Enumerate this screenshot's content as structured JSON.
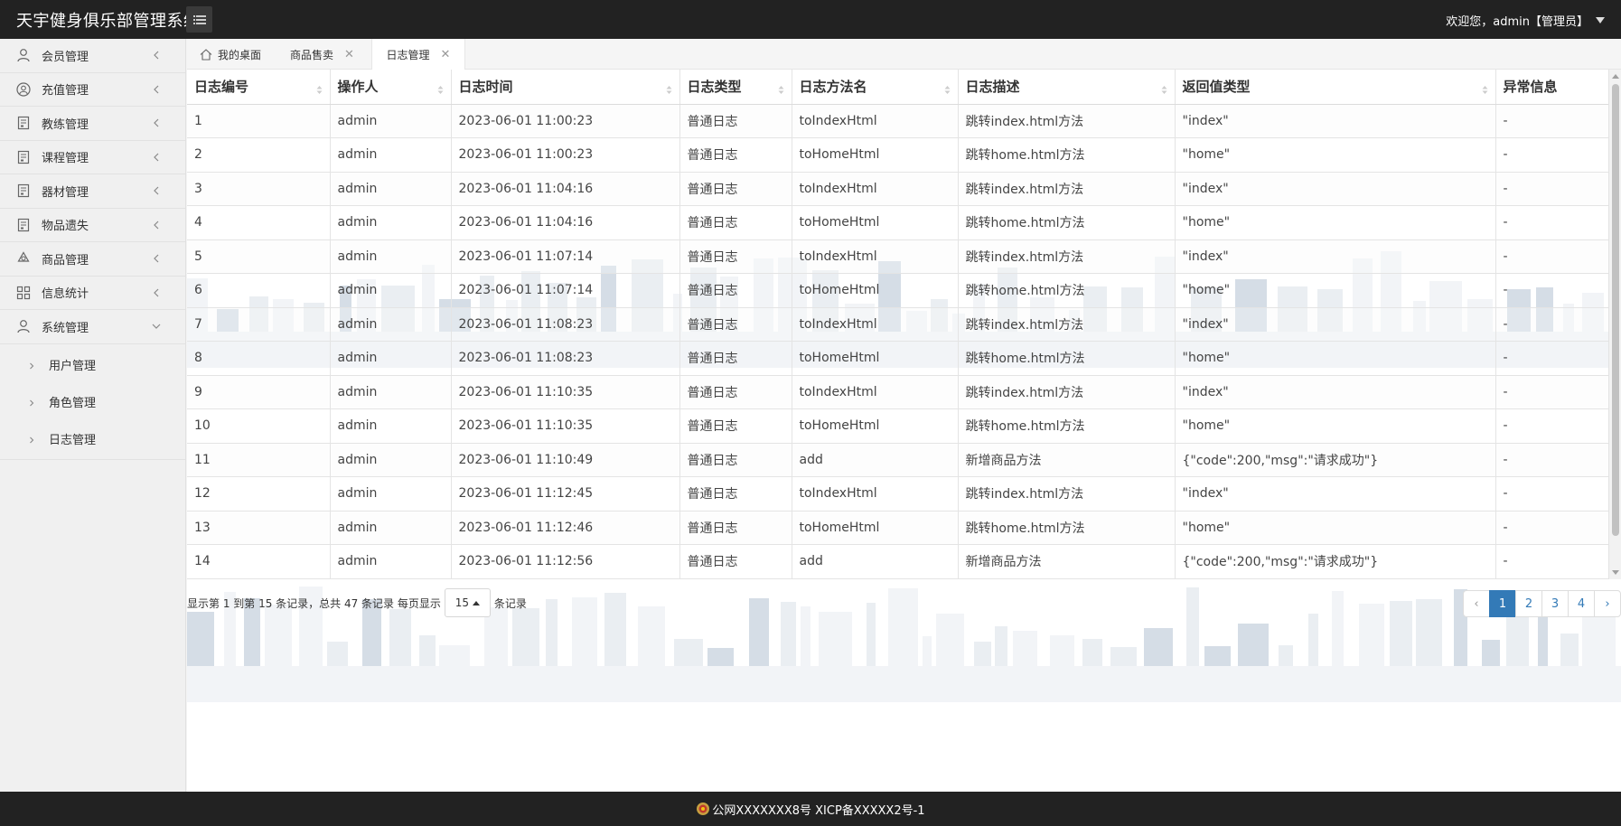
{
  "header": {
    "app_title": "天宇健身俱乐部管理系统",
    "user_text": "欢迎您，admin【管理员】"
  },
  "sidebar": {
    "items": [
      {
        "label": "会员管理",
        "icon": "user-icon"
      },
      {
        "label": "充值管理",
        "icon": "user-circle-icon"
      },
      {
        "label": "教练管理",
        "icon": "doc-icon"
      },
      {
        "label": "课程管理",
        "icon": "doc-icon"
      },
      {
        "label": "器材管理",
        "icon": "doc-icon"
      },
      {
        "label": "物品遗失",
        "icon": "doc-icon"
      },
      {
        "label": "商品管理",
        "icon": "recycle-icon"
      },
      {
        "label": "信息统计",
        "icon": "grid-icon"
      },
      {
        "label": "系统管理",
        "icon": "user-icon"
      }
    ],
    "sub_items": [
      {
        "label": "用户管理"
      },
      {
        "label": "角色管理"
      },
      {
        "label": "日志管理"
      }
    ]
  },
  "tabs": [
    {
      "label": "我的桌面"
    },
    {
      "label": "商品售卖"
    },
    {
      "label": "日志管理"
    }
  ],
  "table": {
    "columns": [
      "日志编号",
      "操作人",
      "日志时间",
      "日志类型",
      "日志方法名",
      "日志描述",
      "返回值类型",
      "异常信息"
    ],
    "rows": [
      [
        "1",
        "admin",
        "2023-06-01 11:00:23",
        "普通日志",
        "toIndexHtml",
        "跳转index.html方法",
        "\"index\"",
        "-"
      ],
      [
        "2",
        "admin",
        "2023-06-01 11:00:23",
        "普通日志",
        "toHomeHtml",
        "跳转home.html方法",
        "\"home\"",
        "-"
      ],
      [
        "3",
        "admin",
        "2023-06-01 11:04:16",
        "普通日志",
        "toIndexHtml",
        "跳转index.html方法",
        "\"index\"",
        "-"
      ],
      [
        "4",
        "admin",
        "2023-06-01 11:04:16",
        "普通日志",
        "toHomeHtml",
        "跳转home.html方法",
        "\"home\"",
        "-"
      ],
      [
        "5",
        "admin",
        "2023-06-01 11:07:14",
        "普通日志",
        "toIndexHtml",
        "跳转index.html方法",
        "\"index\"",
        "-"
      ],
      [
        "6",
        "admin",
        "2023-06-01 11:07:14",
        "普通日志",
        "toHomeHtml",
        "跳转home.html方法",
        "\"home\"",
        "-"
      ],
      [
        "7",
        "admin",
        "2023-06-01 11:08:23",
        "普通日志",
        "toIndexHtml",
        "跳转index.html方法",
        "\"index\"",
        "-"
      ],
      [
        "8",
        "admin",
        "2023-06-01 11:08:23",
        "普通日志",
        "toHomeHtml",
        "跳转home.html方法",
        "\"home\"",
        "-"
      ],
      [
        "9",
        "admin",
        "2023-06-01 11:10:35",
        "普通日志",
        "toIndexHtml",
        "跳转index.html方法",
        "\"index\"",
        "-"
      ],
      [
        "10",
        "admin",
        "2023-06-01 11:10:35",
        "普通日志",
        "toHomeHtml",
        "跳转home.html方法",
        "\"home\"",
        "-"
      ],
      [
        "11",
        "admin",
        "2023-06-01 11:10:49",
        "普通日志",
        "add",
        "新增商品方法",
        "{\"code\":200,\"msg\":\"请求成功\"}",
        "-"
      ],
      [
        "12",
        "admin",
        "2023-06-01 11:12:45",
        "普通日志",
        "toIndexHtml",
        "跳转index.html方法",
        "\"index\"",
        "-"
      ],
      [
        "13",
        "admin",
        "2023-06-01 11:12:46",
        "普通日志",
        "toHomeHtml",
        "跳转home.html方法",
        "\"home\"",
        "-"
      ],
      [
        "14",
        "admin",
        "2023-06-01 11:12:56",
        "普通日志",
        "add",
        "新增商品方法",
        "{\"code\":200,\"msg\":\"请求成功\"}",
        "-"
      ]
    ]
  },
  "pager": {
    "info_before": "显示第 1 到第 15 条记录，总共 47 条记录 每页显示",
    "page_size": "15",
    "info_after": "条记录",
    "prev": "‹",
    "pages": [
      "1",
      "2",
      "3",
      "4"
    ],
    "next": "›",
    "active_page": "1"
  },
  "footer": {
    "text": "公网XXXXXXX8号 XICP备XXXXX2号-1"
  },
  "colors": {
    "topbar": "#222222",
    "accent": "#337ab7",
    "sidebar_bg": "#f0f0f0"
  }
}
